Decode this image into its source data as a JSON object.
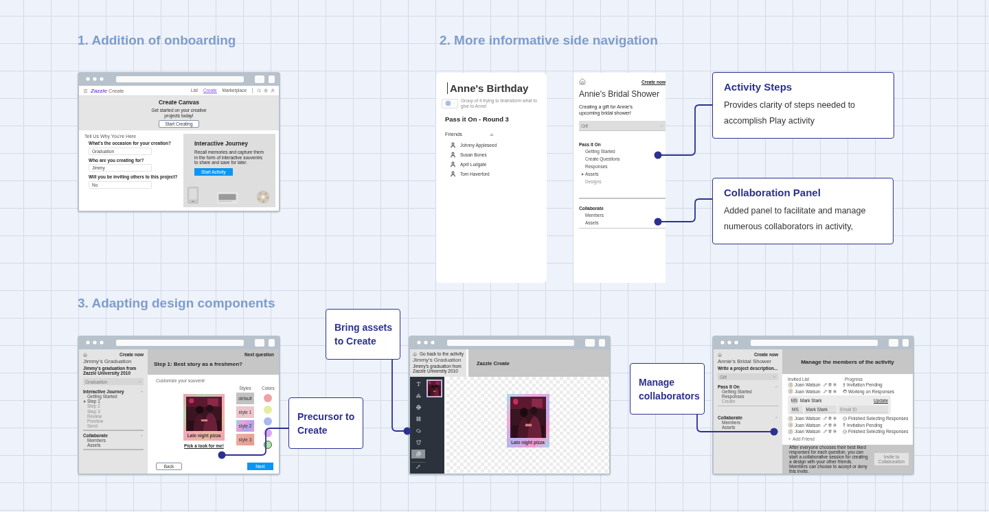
{
  "headings": [
    "1. Addition of onboarding",
    "2. More informative side navigation",
    "3. Adapting design components"
  ],
  "onboarding": {
    "logo": "Zazzle",
    "logo_suffix": "Create",
    "links": [
      {
        "label": "List",
        "selected": false
      },
      {
        "label": "Create",
        "selected": true
      },
      {
        "label": "Marketplace",
        "selected": false
      }
    ],
    "hero": {
      "title": "Create Canvas",
      "text": "Get started on your creative projects today!",
      "button": "Start Creating"
    },
    "form": {
      "title": "Tell Us Why You're Here",
      "fields": [
        {
          "label": "What's the occasion for your creation?",
          "value": "Graduation"
        },
        {
          "label": "Who are you creating for?",
          "value": "Jimmy"
        },
        {
          "label": "Will you be inviting others to this project?",
          "value": "No"
        }
      ]
    },
    "journey": {
      "title": "Interactive Journey",
      "text": "Recall memories and capture them in the form of interactive souvenirs to share and save for later.",
      "button": "Start Activity"
    }
  },
  "side_nav_old": {
    "title": "Anne's Birthday",
    "description": "Group of 4 trying to brainstorm what to give to Anne!",
    "round": "Pass it On - Round 3",
    "friends_label": "Friends",
    "friends": [
      "Johnny Appleseed",
      "Susan Bones",
      "April Ludgate",
      "Tom Haverford"
    ]
  },
  "side_nav_new": {
    "link": "Create now",
    "title": "Annie's Bridal Shower",
    "description": "Creating a gift for Annie's upcoming bridal shower!",
    "dropdown": "Gift",
    "sections": [
      {
        "title": "Pass It On",
        "items": [
          {
            "label": "Getting Started",
            "current": false,
            "disabled": false
          },
          {
            "label": "Create Questions",
            "current": false,
            "disabled": false
          },
          {
            "label": "Responses",
            "current": false,
            "disabled": false
          },
          {
            "label": "Assets",
            "current": true,
            "disabled": false
          },
          {
            "label": "Designs",
            "current": false,
            "disabled": true
          }
        ]
      },
      {
        "title": "Collaborate",
        "items": [
          {
            "label": "Members",
            "current": false,
            "disabled": false
          },
          {
            "label": "Assets",
            "current": false,
            "disabled": false
          }
        ]
      }
    ]
  },
  "callouts": [
    {
      "title": "Activity Steps",
      "text": "Provides clarity of steps needed to accomplish Play activity"
    },
    {
      "title": "Collaboration Panel",
      "text": "Added panel to facilitate and manage numerous collaborators in activity,"
    },
    {
      "title": "Precursor to Create"
    },
    {
      "title": "Bring assets to Create"
    },
    {
      "title": "Manage collaborators"
    }
  ],
  "souvenir": {
    "sidebar": {
      "link": "Create now",
      "title": "Jimmy's Graduation",
      "description": "Jimmy's graduation from Zazzle University 2010",
      "dropdown": "Graduation",
      "sections": [
        {
          "title": "Interactive Journey",
          "items": [
            {
              "label": "Getting Started",
              "current": false,
              "disabled": false
            },
            {
              "label": "Step 1",
              "current": true,
              "disabled": false
            },
            {
              "label": "Step 2",
              "current": false,
              "disabled": true
            },
            {
              "label": "Step 3",
              "current": false,
              "disabled": true
            },
            {
              "label": "Review",
              "current": false,
              "disabled": true
            },
            {
              "label": "Preview",
              "current": false,
              "disabled": true
            },
            {
              "label": "Send",
              "current": false,
              "disabled": true
            }
          ]
        },
        {
          "title": "Collaborate",
          "items": [
            {
              "label": "Members",
              "current": false,
              "disabled": false
            },
            {
              "label": "Assets",
              "current": false,
              "disabled": false
            }
          ]
        }
      ]
    },
    "next_link": "Next question",
    "question": "Step 1: Best story as a freshmen?",
    "subtitle": "Customize your souvenir",
    "card_caption": "Late night pizza",
    "pick_link": "Pick a look for me!",
    "styles_label": "Styles",
    "styles": [
      {
        "label": "default",
        "kind": "plain"
      },
      {
        "label": "style 1",
        "kind": "speckle"
      },
      {
        "label": "style 2",
        "kind": "swirl"
      },
      {
        "label": "style 3",
        "kind": "peach"
      }
    ],
    "colors_label": "Colors",
    "colors": [
      {
        "color": "#f0a3a3",
        "selected": false
      },
      {
        "color": "#e4ee9e",
        "selected": false
      },
      {
        "color": "#a9b8f0",
        "selected": false
      },
      {
        "color": "#dca8ef",
        "selected": false
      },
      {
        "color": "#a8e8a2",
        "selected": true
      }
    ],
    "buttons": [
      "Back",
      "Next"
    ]
  },
  "editor": {
    "back_link": "Go back to the activity",
    "title": "Jimmy's Graduation",
    "description": "Jimmy's graduation from Zazzle University 2010",
    "header": "Zazzle Create",
    "tools": [
      {
        "kind": "text",
        "selected": false
      },
      {
        "kind": "shapes",
        "selected": false
      },
      {
        "kind": "globe",
        "selected": false
      },
      {
        "kind": "grid",
        "selected": false
      },
      {
        "kind": "cloud",
        "selected": false
      },
      {
        "kind": "shirt",
        "selected": false
      },
      {
        "kind": "images",
        "selected": true
      }
    ],
    "card_caption": "Late night pizza"
  },
  "members": {
    "sidebar": {
      "link": "Create now",
      "title": "Annie's Bridal Shower",
      "description": "Write a project description...",
      "dropdown": "Gift",
      "sections": [
        {
          "title": "Pass It On",
          "items": [
            {
              "label": "Getting Started",
              "current": false,
              "disabled": false
            },
            {
              "label": "Responses",
              "current": false,
              "disabled": false
            },
            {
              "label": "Create",
              "current": false,
              "disabled": true
            }
          ]
        },
        {
          "title": "Collaborate",
          "items": [
            {
              "label": "Members",
              "current": false,
              "disabled": false
            },
            {
              "label": "Assets",
              "current": false,
              "disabled": false
            }
          ]
        }
      ]
    },
    "header": "Manage the members of the activity",
    "list_label": "Invited List",
    "progress_label": "Progress",
    "rows": [
      {
        "kind": "member",
        "name": "Joan Watson",
        "status": {
          "kind": "pending",
          "label": "Invitation Pending"
        }
      },
      {
        "kind": "member",
        "name": "Joan Watson",
        "status": {
          "kind": "working",
          "label": "Working on Responses"
        }
      },
      {
        "kind": "edit",
        "initials": "MS",
        "name": "Mark Stark",
        "action": "Update",
        "fields": [
          {
            "value": "MS"
          },
          {
            "value": "Mark Stark"
          },
          {
            "placeholder": "Email ID"
          }
        ]
      },
      {
        "kind": "member",
        "name": "Joan Watson",
        "status": {
          "kind": "finished",
          "label": "Finished Selecting Responses"
        }
      },
      {
        "kind": "member",
        "name": "Joan Watson",
        "status": {
          "kind": "pending",
          "label": "Invitation Pending"
        }
      },
      {
        "kind": "member",
        "name": "Joan Watson",
        "status": {
          "kind": "finished",
          "label": "Finished Selecting Responses"
        }
      }
    ],
    "add_link": "Add Friend",
    "footer_text": "After everyone chooses their best liked responses for each question, you can start a collaborative session for creating a design with your other friends. Members can choose to accept or deny this invite.",
    "footer_button": {
      "label": "Invite to Collaboration",
      "disabled": true
    }
  }
}
